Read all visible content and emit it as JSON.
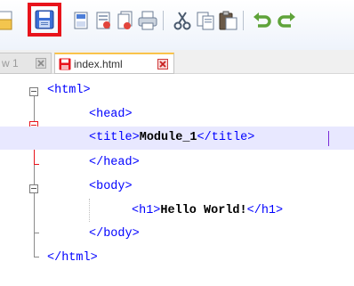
{
  "toolbar": {
    "buttons": [
      {
        "name": "new-file-icon"
      },
      {
        "name": "save-icon",
        "highlighted": true
      },
      {
        "name": "save-all-icon"
      },
      {
        "name": "close-file-icon"
      },
      {
        "name": "close-all-icon"
      },
      {
        "name": "print-icon"
      },
      {
        "name": "cut-icon"
      },
      {
        "name": "copy-icon"
      },
      {
        "name": "paste-icon"
      },
      {
        "name": "undo-icon"
      },
      {
        "name": "redo-icon"
      }
    ],
    "highlight_color": "#e8131b"
  },
  "tabs": [
    {
      "label": "w 1",
      "active": false
    },
    {
      "label": "index.html",
      "active": true
    }
  ],
  "editor": {
    "lines": [
      {
        "indent": "",
        "tag_open": "<html>",
        "text": "",
        "tag_close": ""
      },
      {
        "indent": "    ",
        "tag_open": "<head>",
        "text": "",
        "tag_close": ""
      },
      {
        "indent": "    ",
        "tag_open": "<title>",
        "text": "Module_1",
        "tag_close": "</title>"
      },
      {
        "indent": "    ",
        "tag_open": "</head>",
        "text": "",
        "tag_close": ""
      },
      {
        "indent": "    ",
        "tag_open": "<body>",
        "text": "",
        "tag_close": ""
      },
      {
        "indent": "      ",
        "tag_open": "<h1>",
        "text": "Hello World!",
        "tag_close": "</h1>"
      },
      {
        "indent": "    ",
        "tag_open": "</body>",
        "text": "",
        "tag_close": ""
      },
      {
        "indent": "",
        "tag_open": "</html>",
        "text": "",
        "tag_close": ""
      }
    ],
    "current_line": 3,
    "tag_color": "#0000ff",
    "current_line_color": "#e8e8ff"
  }
}
